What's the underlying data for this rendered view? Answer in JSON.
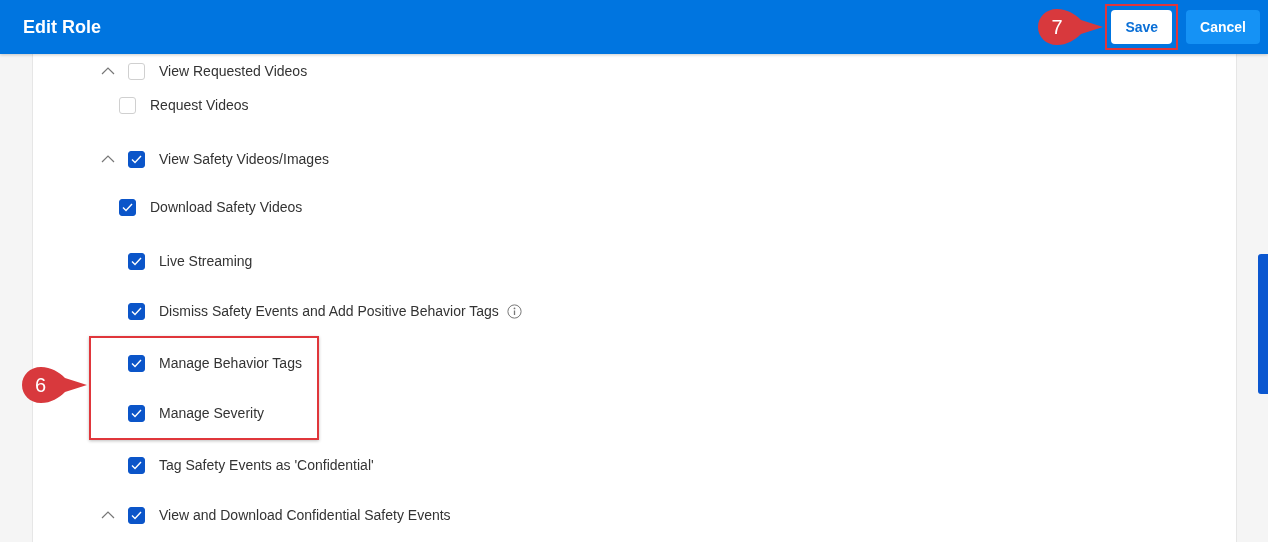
{
  "header": {
    "title": "Edit Role",
    "buttons": [
      {
        "label": "Save",
        "kind": "primary",
        "highlighted": true,
        "callout": "7"
      },
      {
        "label": "Cancel",
        "kind": "secondary",
        "highlighted": false
      }
    ]
  },
  "permissions": [
    {
      "label": "View Requested Videos",
      "kind": "group",
      "checked": false,
      "children": [
        {
          "label": "Request Videos",
          "checked": false
        }
      ]
    },
    {
      "label": "View Safety Videos/Images",
      "kind": "group",
      "checked": true,
      "children": [
        {
          "label": "Download Safety Videos",
          "checked": true
        }
      ]
    },
    {
      "label": "Live Streaming",
      "kind": "item",
      "checked": true
    },
    {
      "label": "Dismiss Safety Events and Add Positive Behavior Tags",
      "kind": "item",
      "checked": true,
      "info": true
    },
    {
      "label": "Manage Behavior Tags",
      "kind": "item",
      "checked": true,
      "highlighted": true
    },
    {
      "label": "Manage Severity",
      "kind": "item",
      "checked": true,
      "highlighted": true
    },
    {
      "label": "Tag Safety Events as 'Confidential'",
      "kind": "item",
      "checked": true
    },
    {
      "label": "View and Download Confidential Safety Events",
      "kind": "group",
      "checked": true
    }
  ],
  "permissions_callout": "6"
}
